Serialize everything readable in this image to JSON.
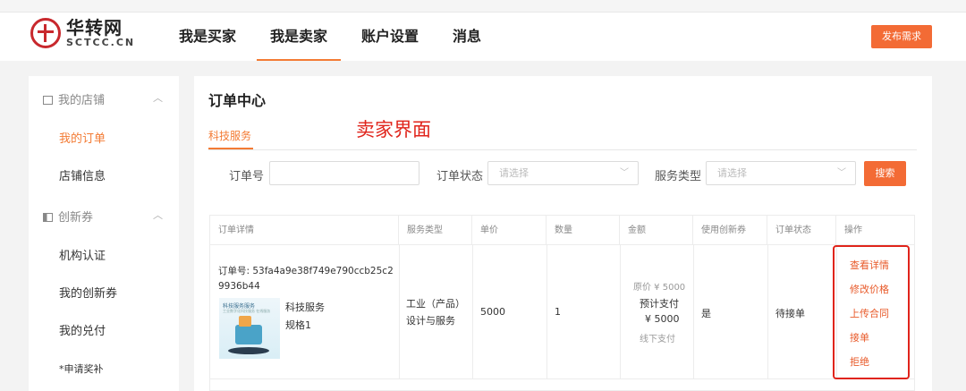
{
  "header": {
    "logo": {
      "name_cn": "华转网",
      "name_en": "SCTCC.CN"
    },
    "nav": [
      {
        "label": "我是买家",
        "active": false
      },
      {
        "label": "我是卖家",
        "active": true
      },
      {
        "label": "账户设置",
        "active": false
      },
      {
        "label": "消息",
        "active": false
      }
    ],
    "publish_button": "发布需求"
  },
  "sidebar": {
    "groups": [
      {
        "label": "我的店铺",
        "icon": "store-icon",
        "items": [
          "我的订单",
          "店铺信息"
        ]
      },
      {
        "label": "创新券",
        "icon": "voucher-icon",
        "items": [
          "机构认证",
          "我的创新券",
          "我的兑付",
          "*申请奖补"
        ]
      }
    ],
    "active_item": "我的订单"
  },
  "main": {
    "title": "订单中心",
    "tab": "科技服务",
    "annotation": "卖家界面",
    "filters": {
      "order_no_label": "订单号",
      "order_no_value": "",
      "status_label": "订单状态",
      "status_placeholder": "请选择",
      "service_label": "服务类型",
      "service_placeholder": "请选择",
      "search_button": "搜索"
    },
    "table": {
      "columns": [
        "订单详情",
        "服务类型",
        "单价",
        "数量",
        "金额",
        "使用创新券",
        "订单状态",
        "操作"
      ],
      "rows": [
        {
          "order_no": "订单号: 53fa4a9e38f749e790ccb25c29936b44",
          "thumb_title": "科技服务服务",
          "thumb_sub": "工业数字化科技服务 在线服务",
          "product_name": "科技服务",
          "spec": "规格1",
          "service_type_1": "工业（产品）",
          "service_type_2": "设计与服务",
          "unit_price": "5000",
          "quantity": "1",
          "original_price": "原价 ¥ 5000",
          "expected_pay_label": "预计支付",
          "expected_pay": "¥ 5000",
          "pay_method": "线下支付",
          "use_voucher": "是",
          "status": "待接单",
          "actions": [
            "查看详情",
            "修改价格",
            "上传合同",
            "接单",
            "拒绝"
          ]
        }
      ]
    }
  },
  "colors": {
    "accent": "#f37b34",
    "button": "#f36b35",
    "annotation_red": "#e0241b"
  }
}
